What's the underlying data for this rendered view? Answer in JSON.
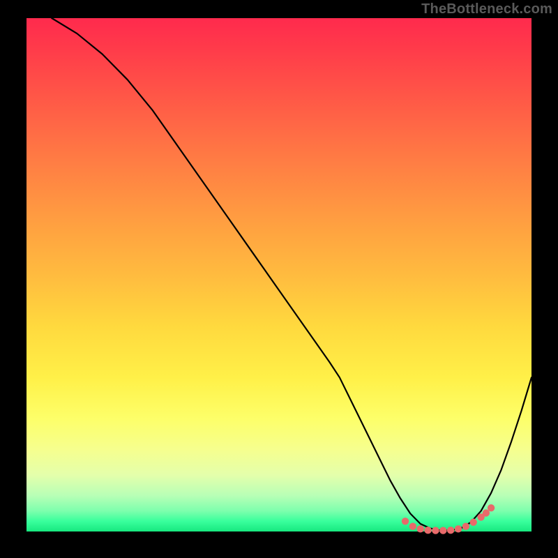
{
  "watermark": "TheBottleneck.com",
  "chart_data": {
    "type": "line",
    "title": "",
    "xlabel": "",
    "ylabel": "",
    "xlim": [
      0,
      100
    ],
    "ylim": [
      0,
      100
    ],
    "series": [
      {
        "name": "curve",
        "x": [
          5,
          10,
          15,
          20,
          25,
          30,
          35,
          40,
          45,
          50,
          55,
          60,
          62,
          65,
          68,
          70,
          72,
          74,
          76,
          78,
          80,
          82,
          84,
          86,
          88,
          90,
          92,
          94,
          96,
          98,
          100
        ],
        "values": [
          100,
          97,
          93,
          88,
          82,
          75,
          68,
          61,
          54,
          47,
          40,
          33,
          30,
          24,
          18,
          14,
          10,
          6.5,
          3.5,
          1.5,
          0.6,
          0.2,
          0.2,
          0.6,
          1.8,
          4.0,
          7.5,
          12.0,
          17.5,
          23.5,
          30
        ]
      },
      {
        "name": "dots",
        "x": [
          75,
          76.5,
          78,
          79.5,
          81,
          82.5,
          84,
          85.5,
          87,
          88.5,
          90,
          91,
          92
        ],
        "values": [
          2.0,
          1.0,
          0.5,
          0.25,
          0.2,
          0.2,
          0.25,
          0.5,
          1.0,
          1.8,
          2.8,
          3.6,
          4.6
        ]
      }
    ],
    "colors": {
      "curve_stroke": "#000000",
      "dot_fill": "#e86a6a",
      "background_top": "#ff2a4d",
      "background_bottom": "#17e87f"
    }
  }
}
